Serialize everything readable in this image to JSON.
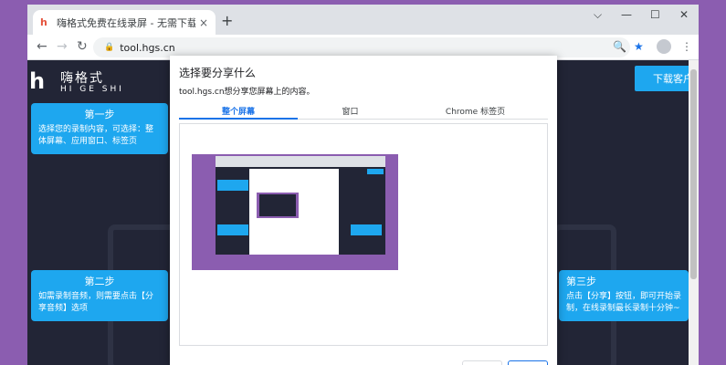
{
  "browser": {
    "tab_title": "嗨格式免费在线录屏 - 无需下载",
    "tab_close": "×",
    "new_tab": "+",
    "url": "tool.hgs.cn",
    "window_controls": [
      "⌵",
      "—",
      "☐",
      "✕"
    ]
  },
  "page": {
    "logo_mark": "h",
    "logo_name": "嗨格式",
    "logo_sub": "HI GE SHI",
    "download_label": "下载客户",
    "steps": [
      {
        "title": "第一步",
        "text": "选择您的录制内容，可选择：整体屏幕、应用窗口、标签页"
      },
      {
        "title": "第二步",
        "text": "如需录制音频，则需要点击【分享音频】选项"
      },
      {
        "title": "第三步",
        "text": "点击【分享】按钮，即可开始录制，在线录制最长录制十分钟~"
      }
    ]
  },
  "dialog": {
    "title": "选择要分享什么",
    "description": "tool.hgs.cn想分享您屏幕上的内容。",
    "tabs": [
      "整个屏幕",
      "窗口",
      "Chrome 标签页"
    ],
    "active_tab": 0
  },
  "icons": {
    "back": "←",
    "forward": "→",
    "reload": "↻",
    "lock": "🔒",
    "zoom": "🔍",
    "star": "★",
    "menu": "⋮"
  }
}
